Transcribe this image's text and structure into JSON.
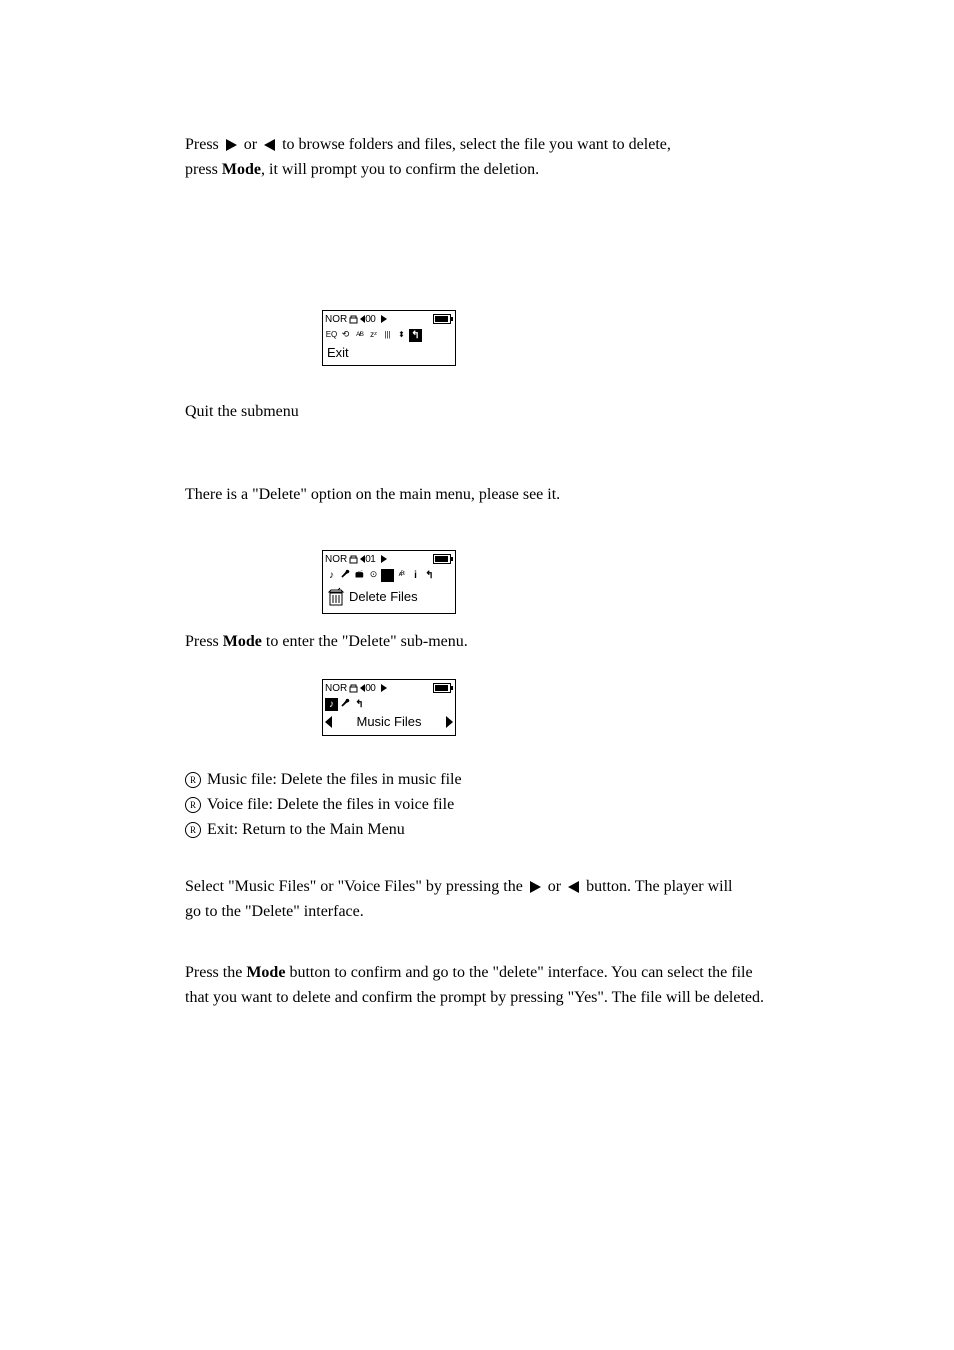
{
  "para1": {
    "t1": "Press",
    "t2": "or",
    "t3": "to browse folders and files, select the file you want to delete,",
    "t4": "press",
    "t5": "Mode",
    "t6": ", it will prompt you to confirm the deletion."
  },
  "lcd1": {
    "nor": "NOR",
    "vol": "00",
    "icons": [
      "eq",
      "loop",
      "ab",
      "zz",
      "bars",
      "speed",
      "exit"
    ],
    "selected": 6,
    "bottom": "Exit"
  },
  "lcd2_label1": "Quit the submenu",
  "lcd2_label2": "There is a \"Delete\" option on the main menu, please see it.",
  "lcd2": {
    "nor": "NOR",
    "vol": "01",
    "icons": [
      "note",
      "mic",
      "fm",
      "rec",
      "del",
      "abc",
      "i",
      "exit"
    ],
    "selected": 4,
    "bottom": "Delete Files"
  },
  "mode_text": {
    "t1": "Press",
    "t2": "Mode",
    "t3": "to enter the \"Delete\" sub-menu."
  },
  "lcd3": {
    "nor": "NOR",
    "vol": "00",
    "icons": [
      "note",
      "mic",
      "exit"
    ],
    "selected": 0,
    "bottom": "Music Files"
  },
  "bullets": {
    "b1": "Music file: Delete the files in music file",
    "b2": "Voice file: Delete the files in voice file",
    "b3": "Exit: Return to the Main Menu"
  },
  "para2": {
    "t1": "Select \"Music Files\" or \"Voice Files\" by pressing the",
    "t2": "or",
    "t3": "button. The player will",
    "t4": "go to the \"Delete\" interface.",
    "t5": "Press the",
    "t6": "Mode",
    "t7": "button to confirm and go to the \"delete\" interface. You can select the file",
    "t8": "that you want to delete and confirm the prompt by pressing \"Yes\". The file will be deleted."
  }
}
